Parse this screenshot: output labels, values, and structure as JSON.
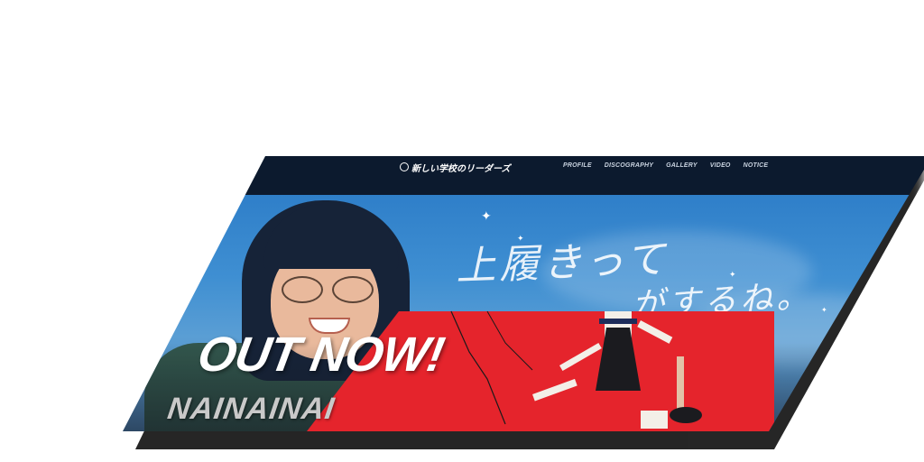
{
  "header": {
    "logo_text": "新しい学校のリーダーズ",
    "nav": [
      {
        "label": "PROFILE"
      },
      {
        "label": "DISCOGRAPHY"
      },
      {
        "label": "GALLERY"
      },
      {
        "label": "VIDEO"
      },
      {
        "label": "NOTICE"
      }
    ]
  },
  "hero": {
    "handwriting_line1": "上履きって",
    "handwriting_line2": "がするね。",
    "headline": "OUT NOW!",
    "release_title": "NAINAINAI"
  },
  "colors": {
    "nav_bg": "#0c1a2e",
    "sky": "#3f8fd2",
    "accent_red": "#e5242c",
    "text_white": "#ffffff"
  }
}
